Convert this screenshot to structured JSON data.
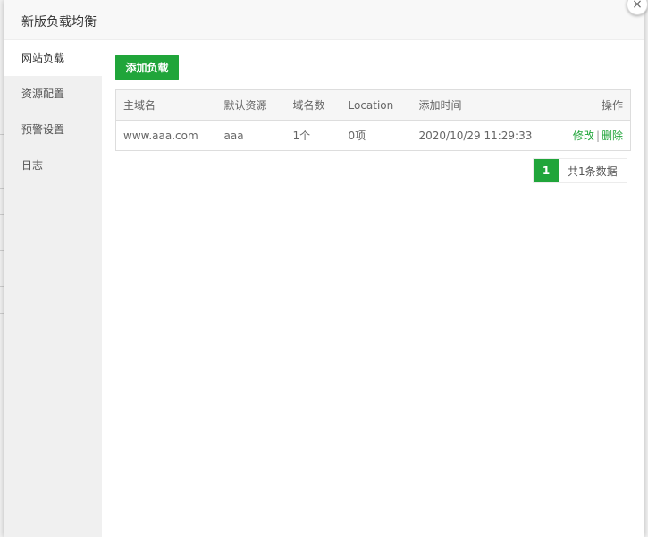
{
  "dialog": {
    "title": "新版负载均衡",
    "close_icon": "×"
  },
  "sidebar": {
    "items": [
      {
        "label": "网站负载",
        "active": true
      },
      {
        "label": "资源配置",
        "active": false
      },
      {
        "label": "预警设置",
        "active": false
      },
      {
        "label": "日志",
        "active": false
      }
    ]
  },
  "toolbar": {
    "add_label": "添加负载"
  },
  "table": {
    "headers": [
      "主域名",
      "默认资源",
      "域名数",
      "Location",
      "添加时间",
      "操作"
    ],
    "rows": [
      {
        "domain": "www.aaa.com",
        "resource": "aaa",
        "domain_count": "1个",
        "location": "0项",
        "added_time": "2020/10/29 11:29:33",
        "action_edit": "修改",
        "action_sep": "|",
        "action_delete": "删除"
      }
    ]
  },
  "pager": {
    "current": "1",
    "total_text": "共1条数据"
  },
  "colors": {
    "accent": "#20a53a"
  }
}
